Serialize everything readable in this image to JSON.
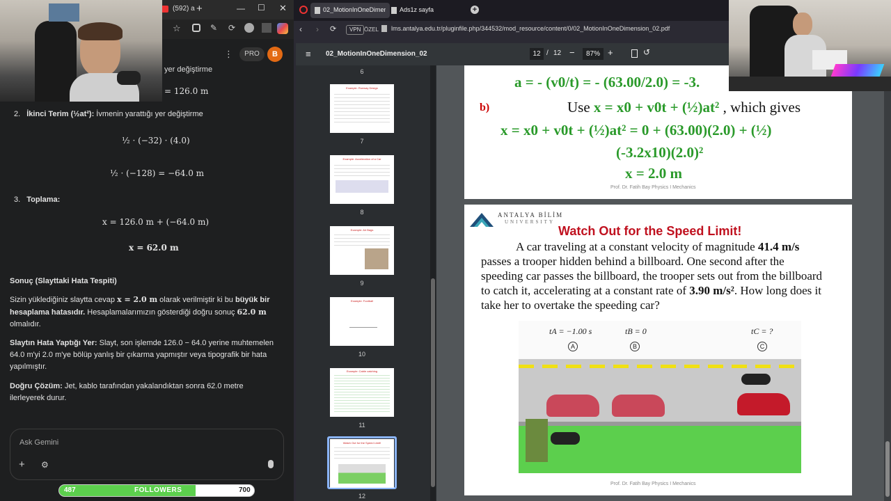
{
  "left": {
    "top_tab_text": "(592) a",
    "pro_label": "PRO",
    "avatar_letter": "B",
    "partial_heading": "yer değiştirme",
    "value_126": "= 126.0 m",
    "item2_number": "2.",
    "item2_title": "İkinci Terim (½at²):",
    "item2_desc": "İvmenin yarattığı yer değiştirme",
    "eq1": "½ · (−32) · (4.0)",
    "eq2": "½ · (−128) = −64.0 m",
    "item3_number": "3.",
    "item3_title": "Toplama:",
    "eq3": "x = 126.0 m + (−64.0 m)",
    "eq4": "x = 62.0 m",
    "conclusion_title": "Sonuç (Slayttaki Hata Tespiti)",
    "p1_a": "Sizin yüklediğiniz slaytta cevap ",
    "p1_math": "x = 2.0 m",
    "p1_b": " olarak verilmiştir ki bu ",
    "p1_bold": "büyük bir hesaplama hatasıdır.",
    "p1_c": " Hesaplamalarımızın gösterdiği doğru sonuç ",
    "p1_math2": "62.0 m",
    "p1_d": " olmalıdır.",
    "p2_bold": "Slaytın Hata Yaptığı Yer:",
    "p2_text": " Slayt, son işlemde 126.0 − 64.0 yerine muhtemelen 64.0 m'yi 2.0 m'ye bölüp yanlış bir çıkarma yapmıştır veya tipografik bir hata yapılmıştır.",
    "p3_bold": "Doğru Çözüm:",
    "p3_text": " Jet, kablo tarafından yakalandıktan sonra 62.0 metre ilerleyerek durur.",
    "ask_placeholder": "Ask Gemini",
    "followers_count": "487",
    "followers_label": "FOLLOWERS",
    "followers_goal": "700",
    "followers_progress": 0.7
  },
  "browser": {
    "tab1": "02_MotionInOneDimensio",
    "tab2": "Ads1z sayfa",
    "vpn": "VPN",
    "ozel": "ÖZEL",
    "url": "lms.antalya.edu.tr/pluginfile.php/344532/mod_resource/content/0/02_MotionInOneDimension_02.pdf",
    "doc_title": "02_MotionInOneDimension_02",
    "page_current": "12",
    "page_sep": "/",
    "page_total": "12",
    "zoom": "87%",
    "thumbs": [
      {
        "num": "6"
      },
      {
        "num": "7",
        "title": "Example: Runway Design"
      },
      {
        "num": "8",
        "title": "Example: Acceleration of a Car"
      },
      {
        "num": "9",
        "title": "Example: Air Bags"
      },
      {
        "num": "10",
        "title": "Example: Football"
      },
      {
        "num": "11",
        "title": "Example: Cable catching"
      },
      {
        "num": "12",
        "title": "Watch Out for the Speed Limit!"
      }
    ]
  },
  "slide11": {
    "line_a": "a = - (v0/t) = - (63.00/2.0) = -3.",
    "b_label": "b)",
    "use_text_a": "Use ",
    "use_eq": "x = x0 + v0t + (½)at²",
    "use_text_b": " , which gives",
    "line2": "x = x0 + v0t + (½)at² = 0 + (63.00)(2.0) + (½)",
    "line3": "(-3.2x10)(2.0)²",
    "line4": "x = 2.0 m",
    "footer": "Prof. Dr. Fatih Bay   Physics I  Mechanics"
  },
  "slide12": {
    "logo_text1": "ANTALYA BİLİM",
    "logo_text2": "UNIVERSITY",
    "title": "Watch Out for the Speed Limit!",
    "body_a": "A car traveling at a constant velocity of magnitude ",
    "body_b1": "41.4 m/s",
    "body_c": " passes a trooper hidden behind a billboard. One second after the speeding car passes the billboard, the trooper sets out from the billboard to catch it, accelerating at a constant rate of ",
    "body_b2": "3.90 m/s²",
    "body_d": ". How long does it take her to overtake the speeding car?",
    "tA": "tA = −1.00 s",
    "tB": "tB = 0",
    "tC": "tC = ?",
    "labelA": "A",
    "labelB": "B",
    "labelC": "C",
    "footer": "Prof. Dr. Fatih Bay   Physics I  Mechanics"
  }
}
